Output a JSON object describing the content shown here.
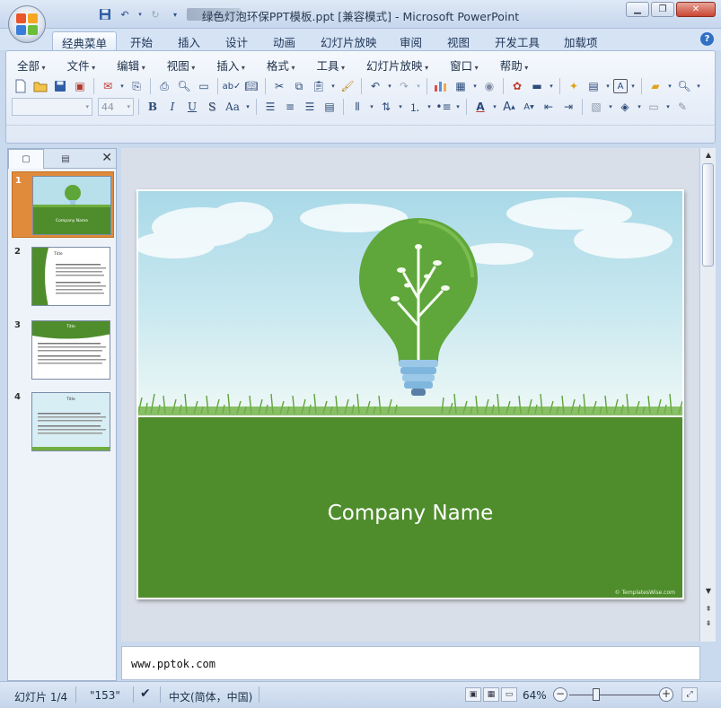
{
  "window": {
    "title": "绿色灯泡环保PPT模板.ppt [兼容模式] - Microsoft PowerPoint",
    "buttons": [
      "▭",
      "▢",
      "✕"
    ]
  },
  "quick_access": [
    "save-icon",
    "undo-icon",
    "redo-icon",
    "customize-icon"
  ],
  "tabs": [
    {
      "label": "经典菜单",
      "active": true
    },
    {
      "label": "开始"
    },
    {
      "label": "插入"
    },
    {
      "label": "设计"
    },
    {
      "label": "动画"
    },
    {
      "label": "幻灯片放映"
    },
    {
      "label": "审阅"
    },
    {
      "label": "视图"
    },
    {
      "label": "开发工具"
    },
    {
      "label": "加载项"
    }
  ],
  "menu": [
    "全部",
    "文件",
    "编辑",
    "视图",
    "插入",
    "格式",
    "工具",
    "幻灯片放映",
    "窗口",
    "帮助"
  ],
  "format_bar": {
    "font_name": "",
    "font_size": "44",
    "bold": "B",
    "italic": "I",
    "underline": "U",
    "shadow": "S",
    "change_case": "Aa"
  },
  "thumbnails": [
    {
      "num": "1",
      "selected": true,
      "caption": "Company Name"
    },
    {
      "num": "2",
      "title": "Title"
    },
    {
      "num": "3",
      "title": "Title"
    },
    {
      "num": "4",
      "title": "Title"
    }
  ],
  "slide": {
    "company": "Company Name",
    "credit": "© TemplatesWise.com"
  },
  "notes": {
    "text": "www.pptok.com"
  },
  "status": {
    "slide_indicator": "幻灯片 1/4",
    "theme": "\"153\"",
    "language": "中文(简体，中国)",
    "zoom": "64%"
  },
  "colors": {
    "slide_green": "#4f8d2c",
    "sky": "#a9d9e8",
    "selected_thumb": "#e08a3c"
  }
}
